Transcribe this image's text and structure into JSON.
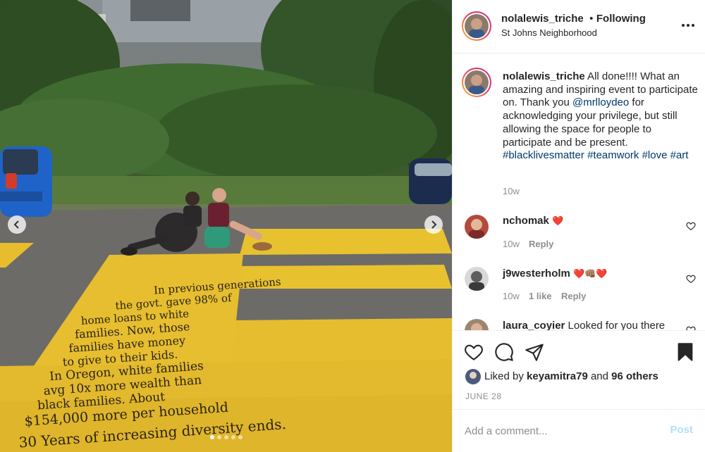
{
  "post": {
    "username": "nolalewis_triche",
    "bullet": "•",
    "follow_status": "Following",
    "location": "St Johns Neighborhood",
    "more_icon": "more-horizontal-icon"
  },
  "caption": {
    "username": "nolalewis_triche",
    "text_1": " All done!!!! What an amazing and inspiring event to participate on. Thank you ",
    "mention": "@mrlloydeo",
    "text_2": " for acknowledging your privilege, but still allowing the space for people to participate and be present. ",
    "tags": [
      "#blacklivesmatter",
      "#teamwork",
      "#love",
      "#art"
    ],
    "time": "10w"
  },
  "comments": [
    {
      "username": "nchomak",
      "text": "❤️",
      "time": "10w",
      "likes": "",
      "reply": "Reply"
    },
    {
      "username": "j9westerholm",
      "text": "❤️👊🏽❤️",
      "time": "10w",
      "likes": "1 like",
      "reply": "Reply"
    },
    {
      "username": "laura_coyier",
      "text": " Looked for you there"
    }
  ],
  "actions": {
    "icons": [
      "heart-icon",
      "comment-icon",
      "share-icon",
      "bookmark-icon"
    ],
    "liked_by_prefix": "Liked by ",
    "liked_by_user": "keyamitra79",
    "liked_by_mid": " and ",
    "liked_by_others": "96 others",
    "date": "JUNE 28"
  },
  "add_comment": {
    "placeholder": "Add a comment...",
    "post_label": "Post"
  },
  "carousel": {
    "total": 5,
    "active": 1,
    "icons": [
      "chevron-left-icon",
      "chevron-right-icon"
    ]
  },
  "street_text": {
    "lines": [
      "In previous generations",
      "the govt. gave 98% of",
      "home loans to white",
      "families. Now, those",
      "families have money",
      "to give to their kids.",
      "In Oregon, white families",
      "avg 10x more wealth than",
      "black families. About",
      "$154,000 more per household",
      "30 Years of increasing diversity ends."
    ]
  }
}
